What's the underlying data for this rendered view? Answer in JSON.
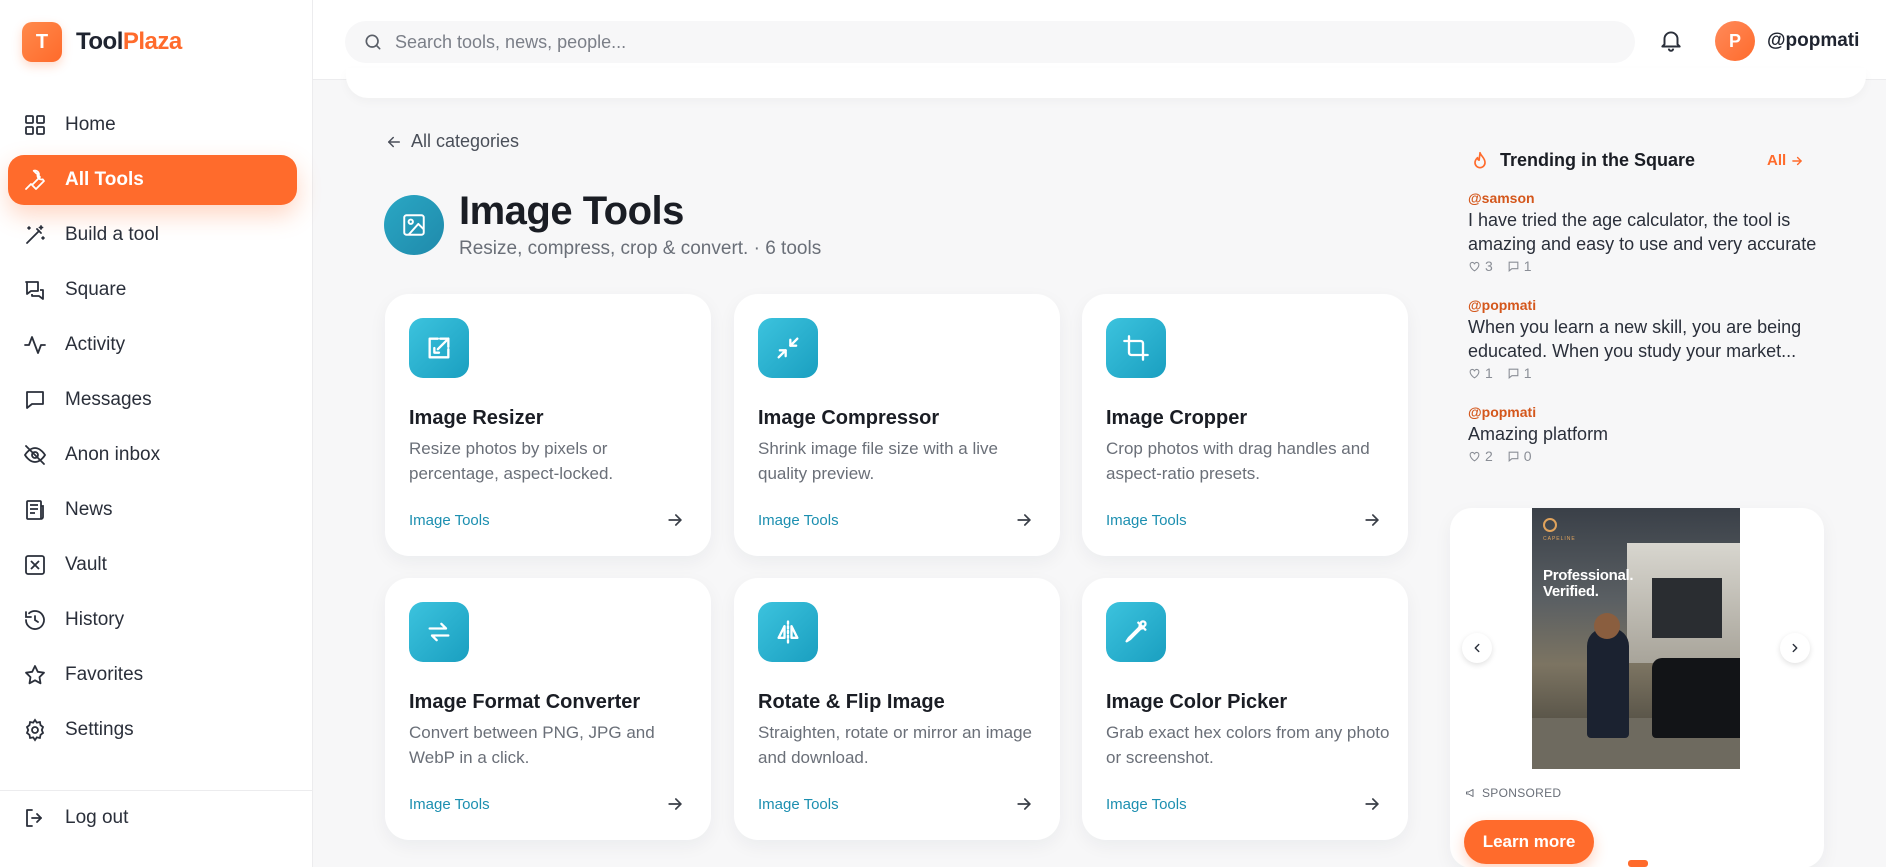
{
  "brand": {
    "logo_letter": "T",
    "name_part1": "Tool",
    "name_part2": "Plaza",
    "accent": "#ff6b2c"
  },
  "sidebar": {
    "items": [
      {
        "label": "Home",
        "icon": "grid-icon",
        "active": false
      },
      {
        "label": "All Tools",
        "icon": "wrench-icon",
        "active": true
      },
      {
        "label": "Build a tool",
        "icon": "magic-wand-icon",
        "active": false
      },
      {
        "label": "Square",
        "icon": "chat-bubbles-icon",
        "active": false
      },
      {
        "label": "Activity",
        "icon": "activity-pulse-icon",
        "active": false
      },
      {
        "label": "Messages",
        "icon": "message-icon",
        "active": false
      },
      {
        "label": "Anon inbox",
        "icon": "eye-off-icon",
        "active": false
      },
      {
        "label": "News",
        "icon": "newspaper-icon",
        "active": false
      },
      {
        "label": "Vault",
        "icon": "vault-icon",
        "active": false
      },
      {
        "label": "History",
        "icon": "history-icon",
        "active": false
      },
      {
        "label": "Favorites",
        "icon": "star-icon",
        "active": false
      },
      {
        "label": "Settings",
        "icon": "gear-icon",
        "active": false
      }
    ],
    "logout_label": "Log out"
  },
  "header": {
    "search_placeholder": "Search tools, news, people...",
    "avatar_initial": "P",
    "username": "@popmati"
  },
  "main": {
    "back_label": "All categories",
    "category_title": "Image Tools",
    "category_subtitle": "Resize, compress, crop & convert. · 6 tools",
    "tools": [
      {
        "title": "Image Resizer",
        "description": "Resize photos by pixels or percentage, aspect-locked.",
        "category": "Image Tools",
        "icon": "resize-icon"
      },
      {
        "title": "Image Compressor",
        "description": "Shrink image file size with a live quality preview.",
        "category": "Image Tools",
        "icon": "compress-icon"
      },
      {
        "title": "Image Cropper",
        "description": "Crop photos with drag handles and aspect-ratio presets.",
        "category": "Image Tools",
        "icon": "crop-icon"
      },
      {
        "title": "Image Format Converter",
        "description": "Convert between PNG, JPG and WebP in a click.",
        "category": "Image Tools",
        "icon": "convert-icon"
      },
      {
        "title": "Rotate & Flip Image",
        "description": "Straighten, rotate or mirror an image and download.",
        "category": "Image Tools",
        "icon": "flip-icon"
      },
      {
        "title": "Image Color Picker",
        "description": "Grab exact hex colors from any photo or screenshot.",
        "category": "Image Tools",
        "icon": "eyedropper-icon"
      }
    ]
  },
  "trending": {
    "title": "Trending in the Square",
    "all_label": "All",
    "posts": [
      {
        "handle": "@samson",
        "text": "I have tried the age calculator, the tool is amazing and easy to use and very accurate",
        "likes": "3",
        "comments": "1"
      },
      {
        "handle": "@popmati",
        "text": "When you learn a new skill, you are being educated. When you study your market...",
        "likes": "1",
        "comments": "1"
      },
      {
        "handle": "@popmati",
        "text": "Amazing platform",
        "likes": "2",
        "comments": "0"
      }
    ]
  },
  "ad": {
    "brand_text": "CAPELINE",
    "headline_line1": "Professional.",
    "headline_line2": "Verified.",
    "sponsored_label": "SPONSORED",
    "cta_label": "Learn more"
  }
}
